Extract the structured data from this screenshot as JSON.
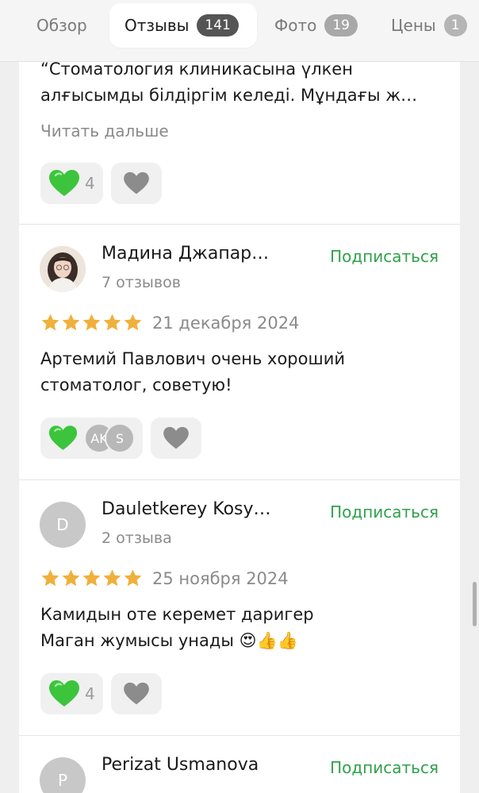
{
  "tabs": [
    {
      "label": "Обзор",
      "badge": null
    },
    {
      "label": "Отзывы",
      "badge": "141"
    },
    {
      "label": "Фото",
      "badge": "19"
    },
    {
      "label": "Цены",
      "badge": "1"
    }
  ],
  "common": {
    "read_more": "Читать дальше",
    "subscribe": "Подписаться"
  },
  "review0": {
    "text": "“Стоматология клиникасына үлкен\nалғысымды білдіргім келеді. Мұндағы ж…",
    "likes": "4"
  },
  "review1": {
    "name": "Мадина Джапар…",
    "reviews_count": "7 отзывов",
    "rating": 5,
    "date": "21 декабря 2024",
    "text": "Артемий Павлович очень хороший\nстоматолог, советую!",
    "likers": [
      "AK",
      "S"
    ]
  },
  "review2": {
    "avatar_letter": "D",
    "name": "Dauletkerey Kosy…",
    "reviews_count": "2 отзыва",
    "rating": 5,
    "date": "25 ноября 2024",
    "text": "Камидын оте керемет даригер\nМаган жумысы унады 😍👍👍",
    "likes": "4"
  },
  "review3": {
    "avatar_letter": "P",
    "name": "Perizat Usmanova"
  },
  "colors": {
    "accent_green": "#2fa14a",
    "star": "#f0b03c",
    "heart_green": "#3cc43c"
  }
}
